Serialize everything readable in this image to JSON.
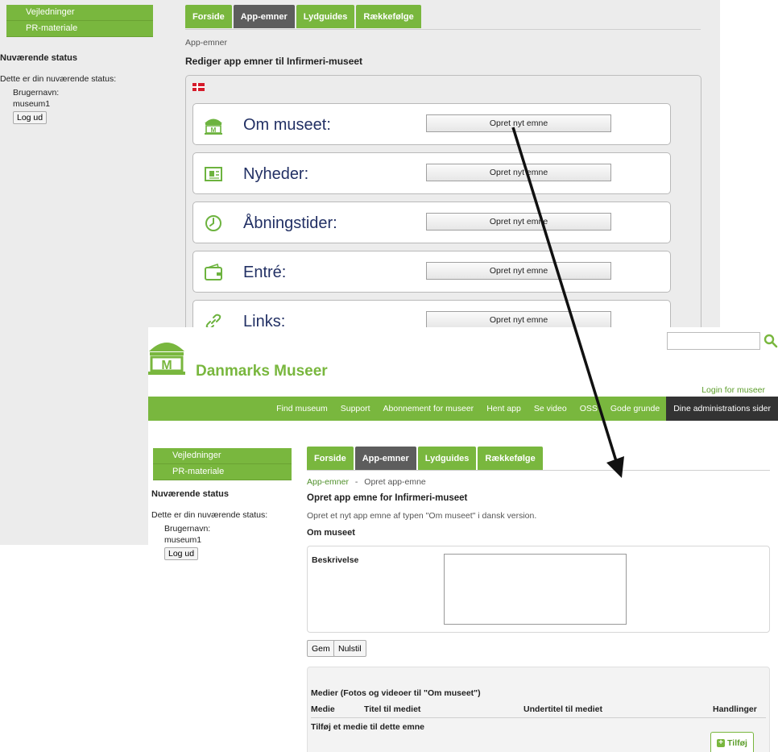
{
  "screen1": {
    "sidebar": {
      "buttons": [
        "Vejledninger",
        "PR-materiale"
      ],
      "status_heading": "Nuværende status",
      "status_text": "Dette er din nuværende status:",
      "username_label": "Brugernavn:",
      "username": "museum1",
      "logout": "Log ud"
    },
    "tabs": [
      "Forside",
      "App-emner",
      "Lydguides",
      "Rækkefølge"
    ],
    "breadcrumb": "App-emner",
    "title": "Rediger app emner til Infirmeri-museet",
    "topics": [
      {
        "label": "Om museet:",
        "button": "Opret nyt emne",
        "icon": "museum-icon"
      },
      {
        "label": "Nyheder:",
        "button": "Opret nyt emne",
        "icon": "newspaper-icon"
      },
      {
        "label": "Åbningstider:",
        "button": "Opret nyt emne",
        "icon": "clock-icon"
      },
      {
        "label": "Entré:",
        "button": "Opret nyt emne",
        "icon": "wallet-icon"
      },
      {
        "label": "Links:",
        "button": "Opret nyt emne",
        "icon": "link-icon"
      }
    ]
  },
  "screen2": {
    "brand": "Danmarks Museer",
    "login_link": "Login for museer",
    "nav": [
      "Find museum",
      "Support",
      "Abonnement for museer",
      "Hent app",
      "Se video",
      "OSS",
      "Gode grunde",
      "Dine administrations sider"
    ],
    "sidebar": {
      "buttons": [
        "Vejledninger",
        "PR-materiale"
      ],
      "status_heading": "Nuværende status",
      "status_text": "Dette er din nuværende status:",
      "username_label": "Brugernavn:",
      "username": "museum1",
      "logout": "Log ud"
    },
    "tabs": [
      "Forside",
      "App-emner",
      "Lydguides",
      "Rækkefølge"
    ],
    "breadcrumb": {
      "link": "App-emner",
      "separator": "-",
      "current": "Opret app-emne"
    },
    "title": "Opret app emne for Infirmeri-museet",
    "subtitle": "Opret et nyt app emne af typen \"Om museet\" i dansk version.",
    "section": "Om museet",
    "description_label": "Beskrivelse",
    "description_value": "",
    "save": "Gem",
    "reset": "Nulstil",
    "media": {
      "title": "Medier (Fotos og videoer til \"Om museet\")",
      "columns": [
        "Medie",
        "Titel til mediet",
        "Undertitel til mediet",
        "Handlinger"
      ],
      "empty": "Tilføj et medie til dette emne",
      "add": "Tilføj"
    }
  },
  "colors": {
    "brand_green": "#79b73e",
    "tab_active": "#5d5d5d",
    "nav_dark": "#333333",
    "topic_text": "#223064"
  }
}
